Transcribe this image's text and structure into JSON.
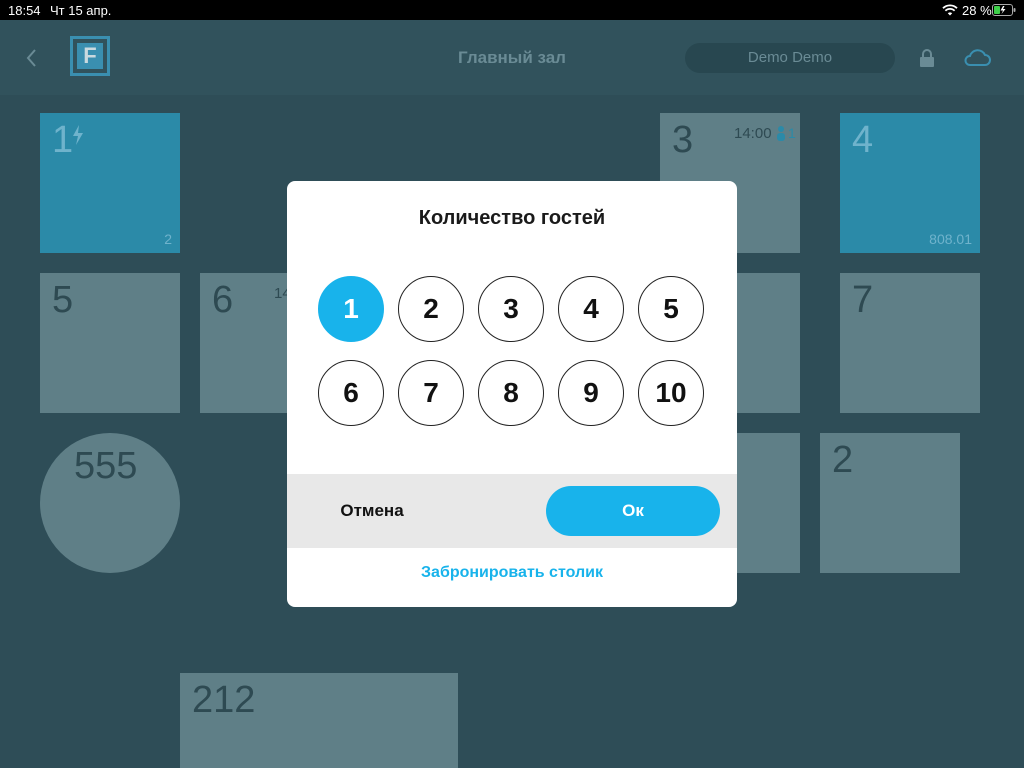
{
  "status_bar": {
    "time": "18:54",
    "date": "Чт 15 апр.",
    "battery": "28 %"
  },
  "header": {
    "title": "Главный зал",
    "user": "Demo Demo"
  },
  "tables": [
    {
      "id": "t1",
      "label": "1",
      "badge": "2",
      "style": "blue",
      "icon": "lightning-icon"
    },
    {
      "id": "t3",
      "label": "3",
      "time": "14:00",
      "guests_icon": "person-icon",
      "guests": "1"
    },
    {
      "id": "t4",
      "label": "4",
      "badge": "808.01",
      "style": "blue"
    },
    {
      "id": "t5",
      "label": "5"
    },
    {
      "id": "t6",
      "label": "6",
      "time": "14"
    },
    {
      "id": "t7",
      "label": "7"
    },
    {
      "id": "t555",
      "label": "555",
      "shape": "round"
    },
    {
      "id": "t2",
      "label": "2"
    },
    {
      "id": "t212",
      "label": "212"
    }
  ],
  "modal": {
    "title": "Количество гостей",
    "options": [
      "1",
      "2",
      "3",
      "4",
      "5",
      "6",
      "7",
      "8",
      "9",
      "10"
    ],
    "selected": "1",
    "cancel_label": "Отмена",
    "ok_label": "Ок",
    "reserve_label": "Забронировать столик"
  },
  "colors": {
    "accent": "#18b3eb",
    "background": "#2e4d57"
  }
}
